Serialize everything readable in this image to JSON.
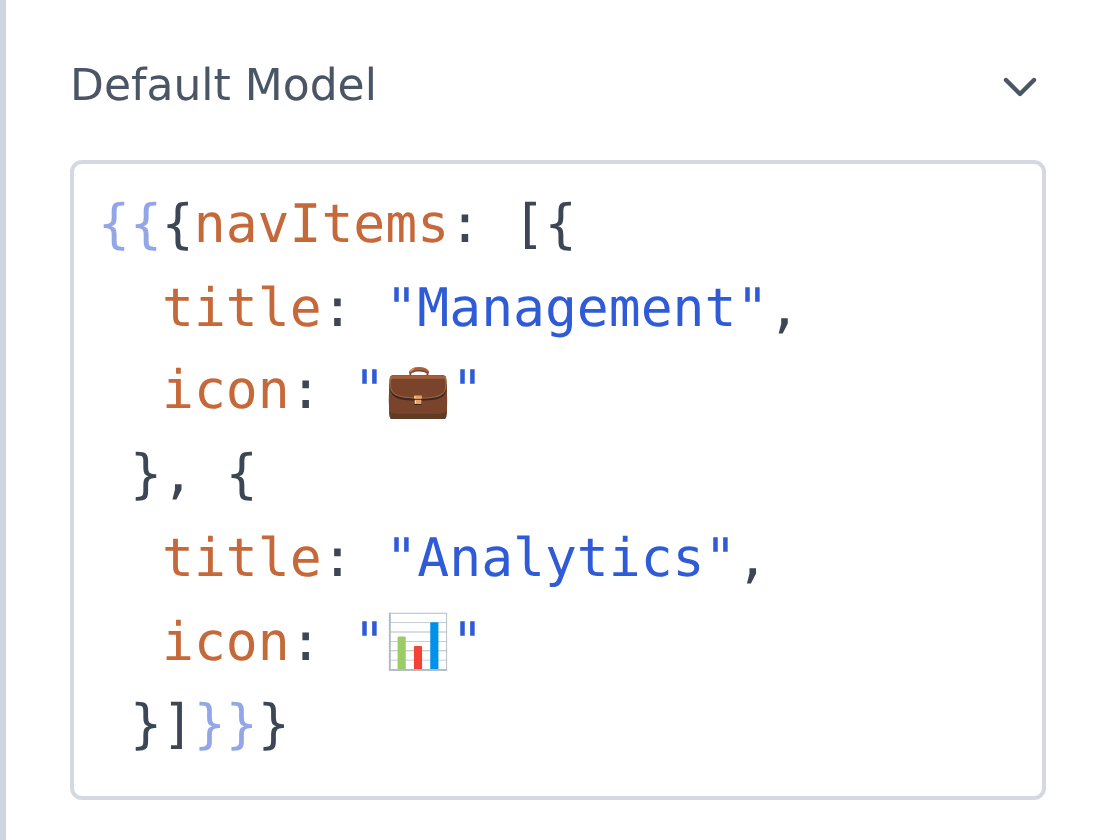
{
  "section": {
    "title": "Default Model",
    "expanded": true
  },
  "code_lines": [
    {
      "kind": "open",
      "tokens": [
        {
          "kind": "template",
          "text": "{{"
        },
        {
          "kind": "punct",
          "text": "{"
        },
        {
          "kind": "key",
          "text": "navItems"
        },
        {
          "kind": "punct",
          "text": ": [{"
        }
      ]
    },
    {
      "kind": "field",
      "tokens": [
        {
          "kind": "key",
          "text": "title"
        },
        {
          "kind": "punct",
          "text": ": "
        },
        {
          "kind": "string",
          "text": "\"Management\""
        },
        {
          "kind": "punct",
          "text": ","
        }
      ]
    },
    {
      "kind": "field",
      "tokens": [
        {
          "kind": "key",
          "text": "icon"
        },
        {
          "kind": "punct",
          "text": ": "
        },
        {
          "kind": "string",
          "text": "\"💼\""
        }
      ]
    },
    {
      "kind": "inner",
      "tokens": [
        {
          "kind": "punct",
          "text": "}, {"
        }
      ]
    },
    {
      "kind": "field",
      "tokens": [
        {
          "kind": "key",
          "text": "title"
        },
        {
          "kind": "punct",
          "text": ": "
        },
        {
          "kind": "string",
          "text": "\"Analytics\""
        },
        {
          "kind": "punct",
          "text": ","
        }
      ]
    },
    {
      "kind": "field",
      "tokens": [
        {
          "kind": "key",
          "text": "icon"
        },
        {
          "kind": "punct",
          "text": ": "
        },
        {
          "kind": "string",
          "text": "\"📊\""
        }
      ]
    },
    {
      "kind": "inner",
      "tokens": [
        {
          "kind": "punct",
          "text": "}]"
        },
        {
          "kind": "template",
          "text": "}}"
        },
        {
          "kind": "punct",
          "text": "}"
        }
      ]
    }
  ]
}
